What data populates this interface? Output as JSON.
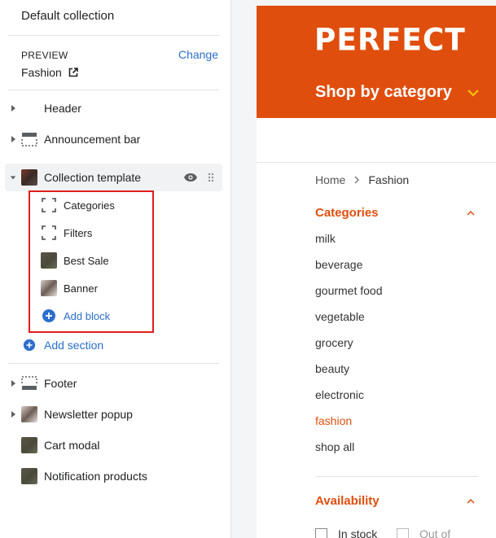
{
  "sidebar": {
    "title": "Default collection",
    "preview_label": "PREVIEW",
    "preview_value": "Fashion",
    "change_link": "Change",
    "sections_top": [
      {
        "label": "Header",
        "icon": "none"
      },
      {
        "label": "Announcement bar",
        "icon": "announcement-bar-icon"
      }
    ],
    "collection": {
      "label": "Collection template",
      "blocks": [
        {
          "label": "Categories",
          "icon": "dashed-square-icon"
        },
        {
          "label": "Filters",
          "icon": "dashed-square-icon"
        },
        {
          "label": "Best Sale",
          "icon": "image-thumbnail"
        },
        {
          "label": "Banner",
          "icon": "image-thumbnail"
        }
      ],
      "add_block": "Add block"
    },
    "add_section": "Add section",
    "sections_bottom": [
      {
        "label": "Footer",
        "icon": "footer-icon"
      },
      {
        "label": "Newsletter popup",
        "icon": "image-thumbnail"
      },
      {
        "label": "Cart modal",
        "icon": "image-thumbnail"
      },
      {
        "label": "Notification products",
        "icon": "image-thumbnail"
      }
    ]
  },
  "store": {
    "logo": "PERFECT",
    "shop_by_category": "Shop by category",
    "breadcrumb": {
      "home": "Home",
      "current": "Fashion"
    },
    "categories_title": "Categories",
    "categories": [
      "milk",
      "beverage",
      "gourmet food",
      "vegetable",
      "grocery",
      "beauty",
      "electronic",
      "fashion",
      "shop all"
    ],
    "active_category": "fashion",
    "availability_title": "Availability",
    "availability_options": [
      "In stock",
      "Out of"
    ]
  },
  "colors": {
    "brand": "#e04e0e",
    "link": "#2c6ecb",
    "highlight": "#e01e1e",
    "chevron": "#f5c400"
  }
}
